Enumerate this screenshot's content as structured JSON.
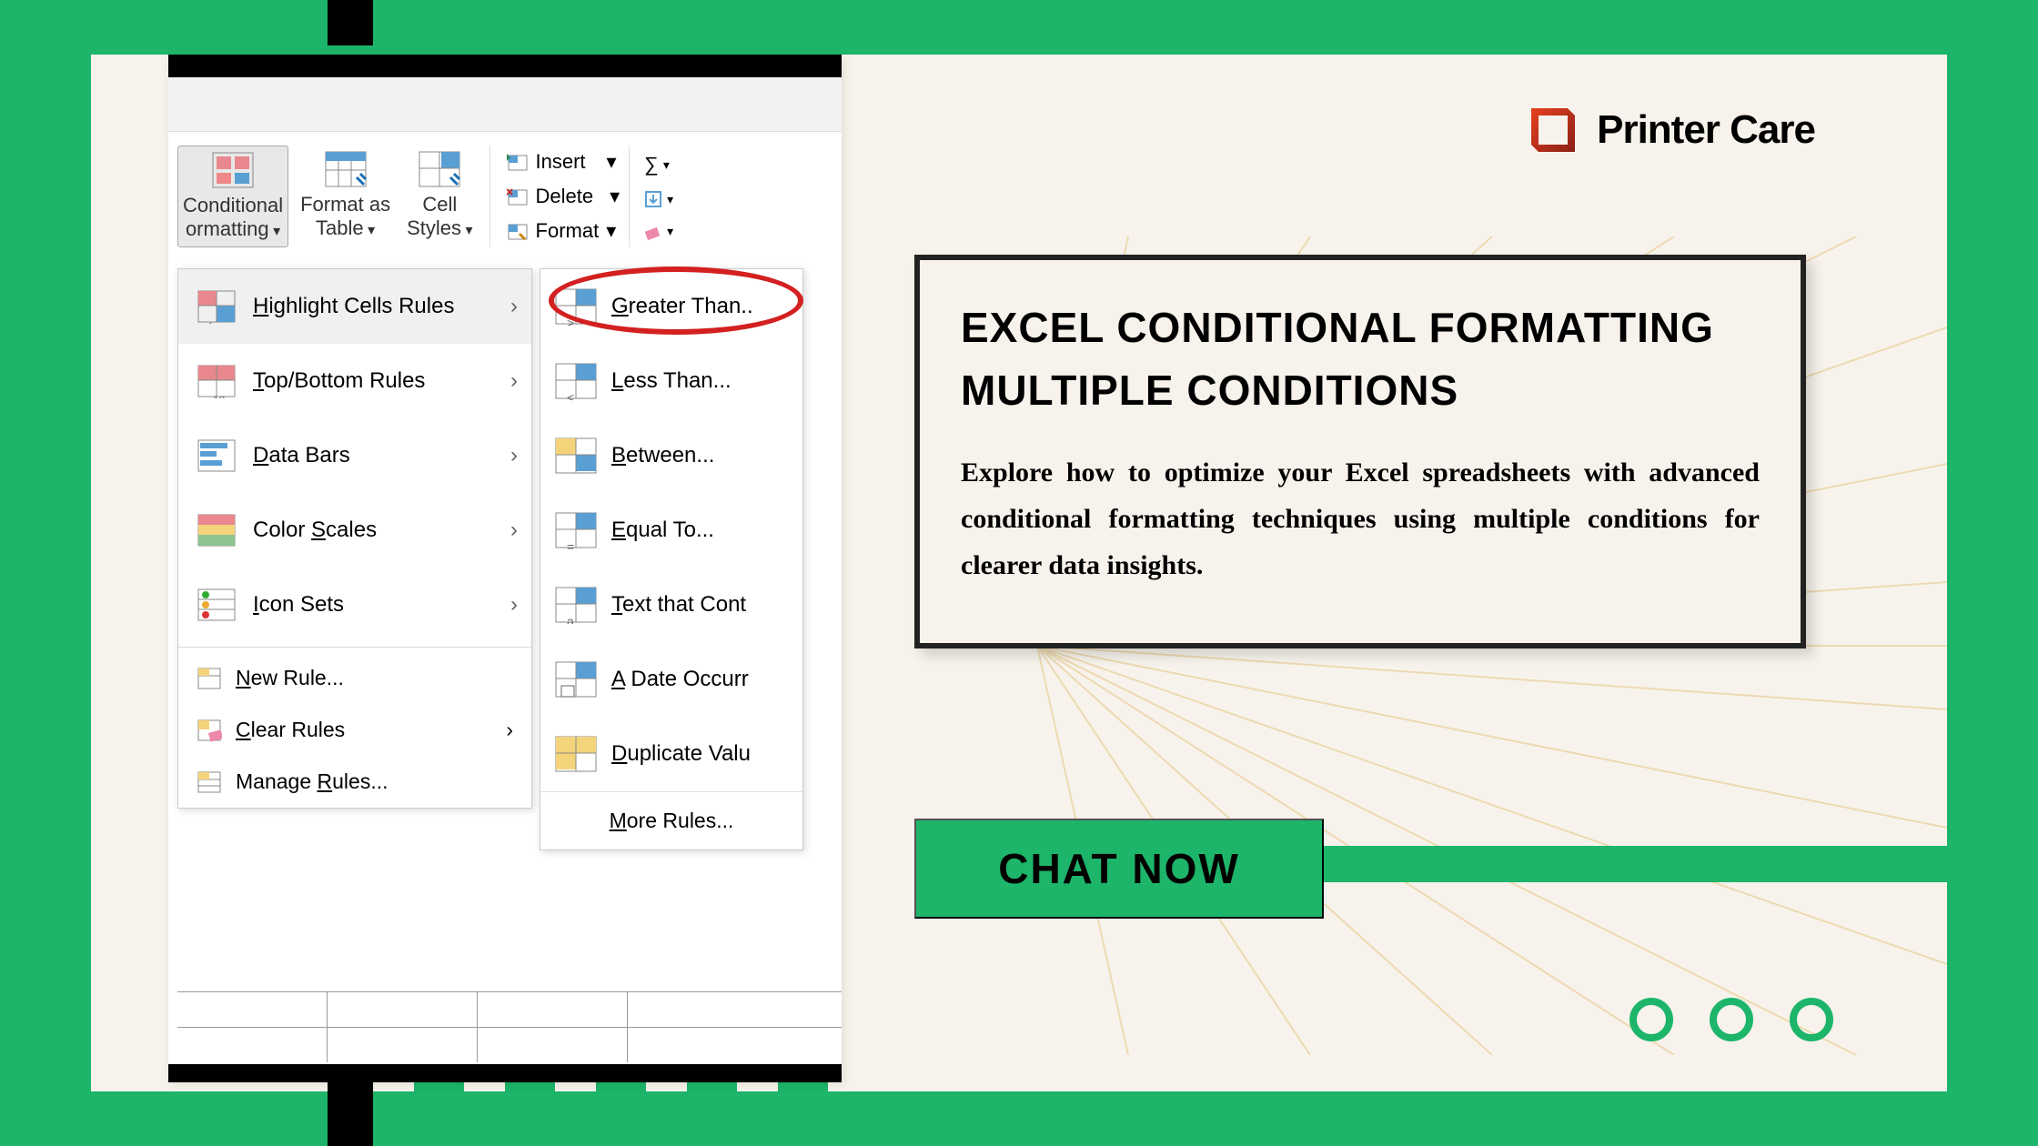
{
  "brand": {
    "name": "Printer Care"
  },
  "ribbon": {
    "conditional_formatting": "Conditional\normatting",
    "format_as_table": "Format as\nTable",
    "cell_styles": "Cell\nStyles",
    "insert": "Insert",
    "delete": "Delete",
    "format": "Format"
  },
  "main_menu": {
    "highlight": "Highlight Cells Rules",
    "topbottom": "Top/Bottom Rules",
    "databars": "Data Bars",
    "colorscales": "Color Scales",
    "iconsets": "Icon Sets",
    "newrule": "New Rule...",
    "clearrules": "Clear Rules",
    "managerules": "Manage Rules..."
  },
  "submenu": {
    "greater": "Greater Than..",
    "less": "Less Than...",
    "between": "Between...",
    "equal": "Equal To...",
    "textcontains": "Text that Cont",
    "dateoccur": "A Date Occurr",
    "duplicate": "Duplicate Valu",
    "morerules": "More Rules..."
  },
  "main_card": {
    "title": "EXCEL CONDITIONAL FORMATTING MULTIPLE CONDITIONS",
    "desc": "Explore how to optimize your Excel spreadsheets with advanced conditional formatting techniques using multiple conditions for clearer data insights."
  },
  "cta": {
    "chat": "CHAT NOW"
  }
}
